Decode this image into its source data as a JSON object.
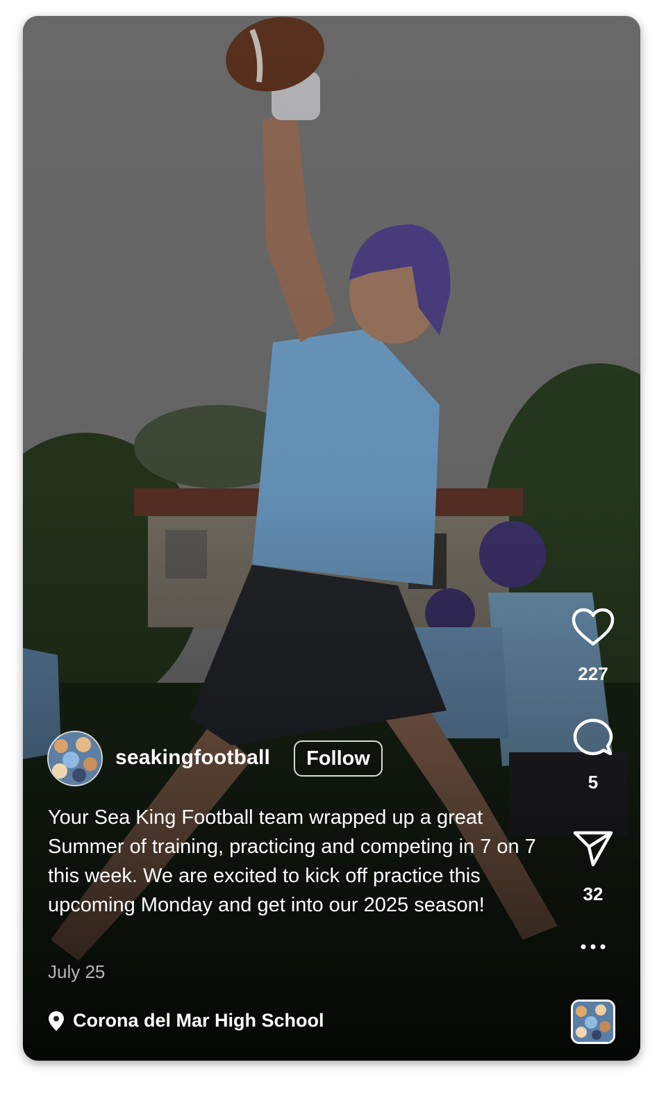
{
  "post": {
    "username": "seakingfootball",
    "follow_label": "Follow",
    "caption": "Your Sea King Football team wrapped up a great Summer of training, practicing and competing in 7 on 7 this week. We are excited to kick off practice this upcoming Monday and get into our 2025 season!",
    "date": "July 25",
    "location": "Corona del Mar High School"
  },
  "actions": {
    "likes": "227",
    "comments": "5",
    "shares": "32"
  },
  "icons": {
    "like": "heart-icon",
    "comment": "comment-bubble-icon",
    "share": "send-paper-plane-icon",
    "more": "more-dots-icon",
    "location": "location-pin-icon"
  },
  "colors": {
    "jersey": "#7fb7e6",
    "helmet": "#5a4a9a",
    "text": "#ffffff"
  }
}
